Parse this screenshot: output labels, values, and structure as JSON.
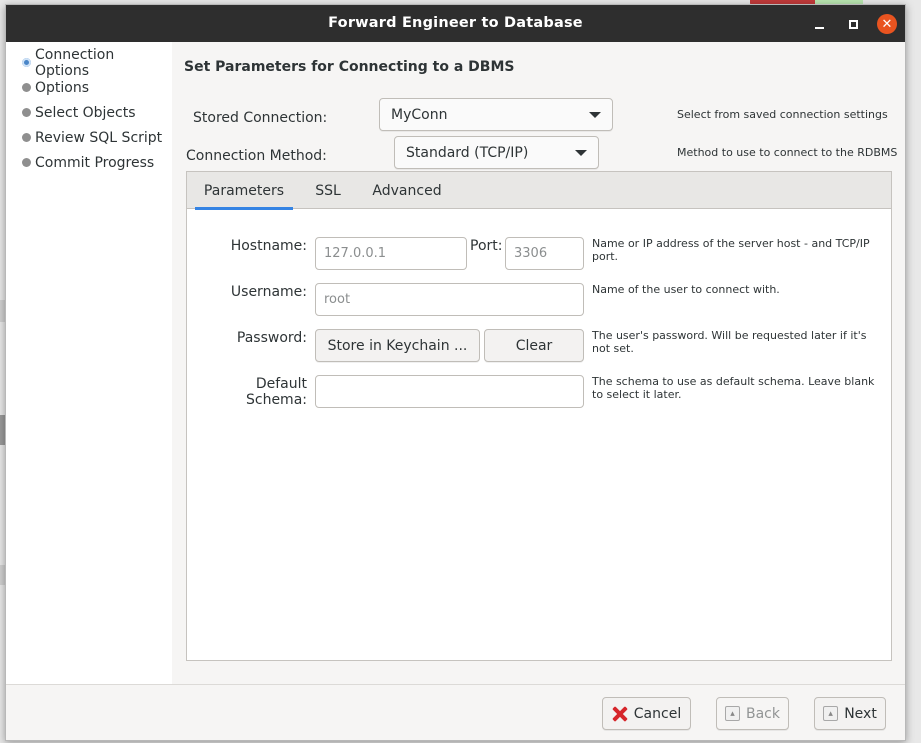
{
  "window": {
    "title": "Forward Engineer to Database"
  },
  "sidebar": {
    "items": [
      {
        "label": "Connection Options"
      },
      {
        "label": "Options"
      },
      {
        "label": "Select Objects"
      },
      {
        "label": "Review SQL Script"
      },
      {
        "label": "Commit Progress"
      }
    ],
    "active_index": 0
  },
  "main": {
    "section_title": "Set Parameters for Connecting to a DBMS",
    "stored_connection": {
      "label": "Stored Connection:",
      "value": "MyConn",
      "hint": "Select from saved connection settings"
    },
    "connection_method": {
      "label": "Connection Method:",
      "value": "Standard (TCP/IP)",
      "hint": "Method to use to connect to the RDBMS"
    },
    "tabs": [
      {
        "label": "Parameters"
      },
      {
        "label": "SSL"
      },
      {
        "label": "Advanced"
      }
    ],
    "active_tab": 0,
    "params": {
      "hostname": {
        "label": "Hostname:",
        "placeholder": "127.0.0.1",
        "value": ""
      },
      "port": {
        "label": "Port:",
        "placeholder": "3306",
        "value": "",
        "hint": "Name or IP address of the server host - and TCP/IP port."
      },
      "username": {
        "label": "Username:",
        "placeholder": "root",
        "value": "",
        "hint": "Name of the user to connect with."
      },
      "password": {
        "label": "Password:",
        "store_label": "Store in Keychain ...",
        "clear_label": "Clear",
        "hint": "The user's password. Will be requested later if it's not set."
      },
      "default_schema": {
        "label": "Default Schema:",
        "placeholder": "",
        "value": "",
        "hint": "The schema to use as default schema. Leave blank to select it later."
      }
    }
  },
  "footer": {
    "cancel_label": "Cancel",
    "back_label": "Back",
    "next_label": "Next"
  },
  "colors": {
    "titlebar": "#2e2e2e",
    "close_button": "#e95420",
    "tab_underline": "#3584e4",
    "active_dot": "#4a86c8"
  }
}
